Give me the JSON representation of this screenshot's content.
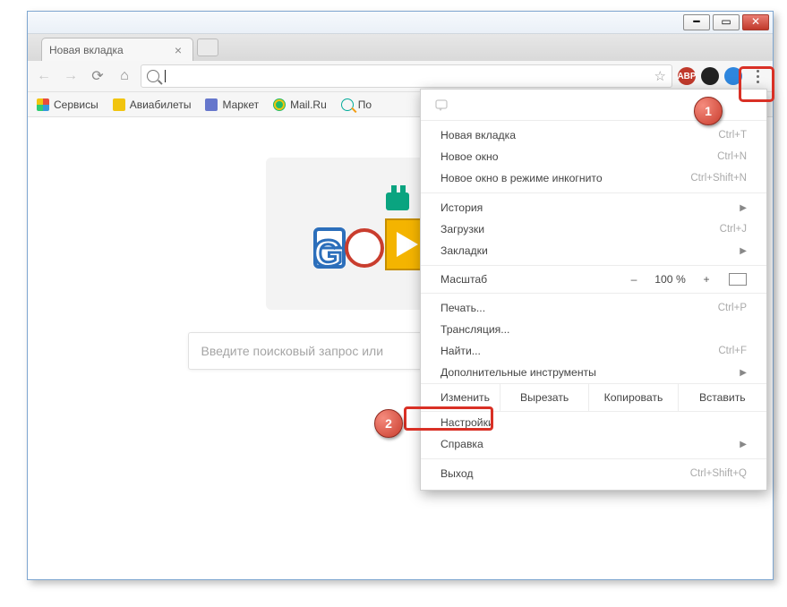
{
  "window": {
    "tab_title": "Новая вкладка"
  },
  "toolbar": {
    "omnibox_value": "",
    "ext_abp": "ABP"
  },
  "bookmarks": {
    "apps": "Сервисы",
    "flights": "Авиабилеты",
    "market": "Маркет",
    "mail": "Mail.Ru",
    "search_fragment": "По"
  },
  "content": {
    "search_placeholder": "Введите поисковый запрос или"
  },
  "menu": {
    "new_tab": "Новая вкладка",
    "new_tab_hint": "Ctrl+T",
    "new_window": "Новое окно",
    "new_window_hint": "Ctrl+N",
    "incognito": "Новое окно в режиме инкогнито",
    "incognito_hint": "Ctrl+Shift+N",
    "history": "История",
    "downloads": "Загрузки",
    "downloads_hint": "Ctrl+J",
    "bookmarks": "Закладки",
    "zoom_label": "Масштаб",
    "zoom_minus": "–",
    "zoom_pct": "100 %",
    "zoom_plus": "+",
    "print": "Печать...",
    "print_hint": "Ctrl+P",
    "cast": "Трансляция...",
    "find": "Найти...",
    "find_hint": "Ctrl+F",
    "more_tools": "Дополнительные инструменты",
    "edit_label": "Изменить",
    "cut": "Вырезать",
    "copy": "Копировать",
    "paste": "Вставить",
    "settings": "Настройки",
    "help": "Справка",
    "exit": "Выход",
    "exit_hint": "Ctrl+Shift+Q"
  },
  "callouts": {
    "one": "1",
    "two": "2"
  }
}
